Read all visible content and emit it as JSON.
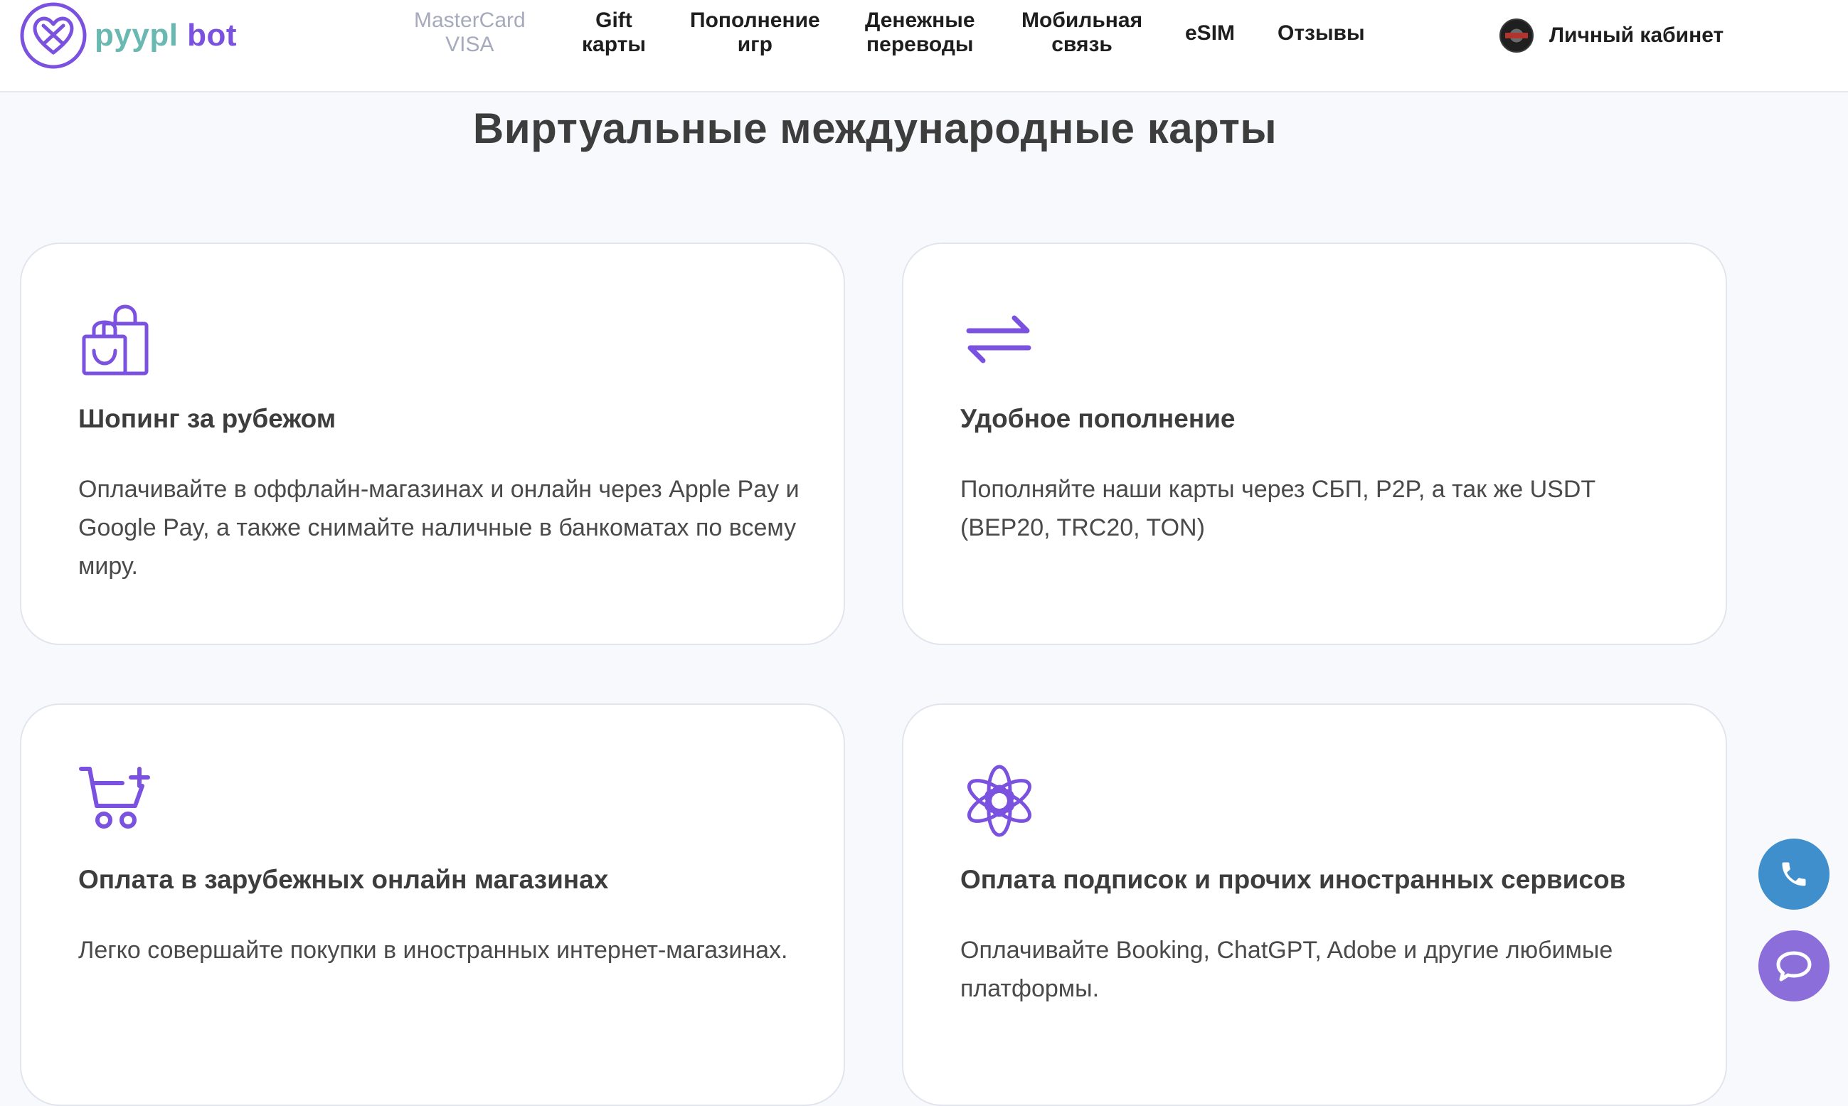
{
  "logo": {
    "text_part1": "pyypl",
    "text_part2": "bot"
  },
  "nav": {
    "mastercard": [
      "MasterCard",
      "VISA"
    ],
    "gift": [
      "Gift",
      "карты"
    ],
    "games": [
      "Пополнение",
      "игр"
    ],
    "transfers": [
      "Денежные",
      "переводы"
    ],
    "mobile": [
      "Мобильная",
      "связь"
    ],
    "esim": "eSIM",
    "reviews": "Отзывы",
    "account": "Личный кабинет"
  },
  "page_title": "Виртуальные международные карты",
  "cards": [
    {
      "icon": "shopping-bags-icon",
      "title": "Шопинг за рубежом",
      "text": "Оплачивайте в оффлайн-магазинах и онлайн через Apple Pay и Google Pay, а также снимайте наличные в банкоматах по всему миру."
    },
    {
      "icon": "exchange-arrows-icon",
      "title": "Удобное пополнение",
      "text": "Пополняйте наши карты через СБП, P2P, а так же USDT (BEP20, TRC20, TON)"
    },
    {
      "icon": "cart-add-icon",
      "title": "Оплата в зарубежных онлайн магазинах",
      "text": "Легко совершайте покупки в иностранных интернет-магазинах."
    },
    {
      "icon": "openai-logo-icon",
      "title": "Оплата подписок и прочих иностранных сервисов",
      "text": "Оплачивайте Booking, ChatGPT, Adobe и другие любимые платформы."
    }
  ],
  "colors": {
    "accent": "#7b52e0",
    "logo_teal": "#69b9b2",
    "phone_button": "#3f8fcc",
    "chat_button": "#8b6ed9",
    "background": "#f8f9fd"
  }
}
